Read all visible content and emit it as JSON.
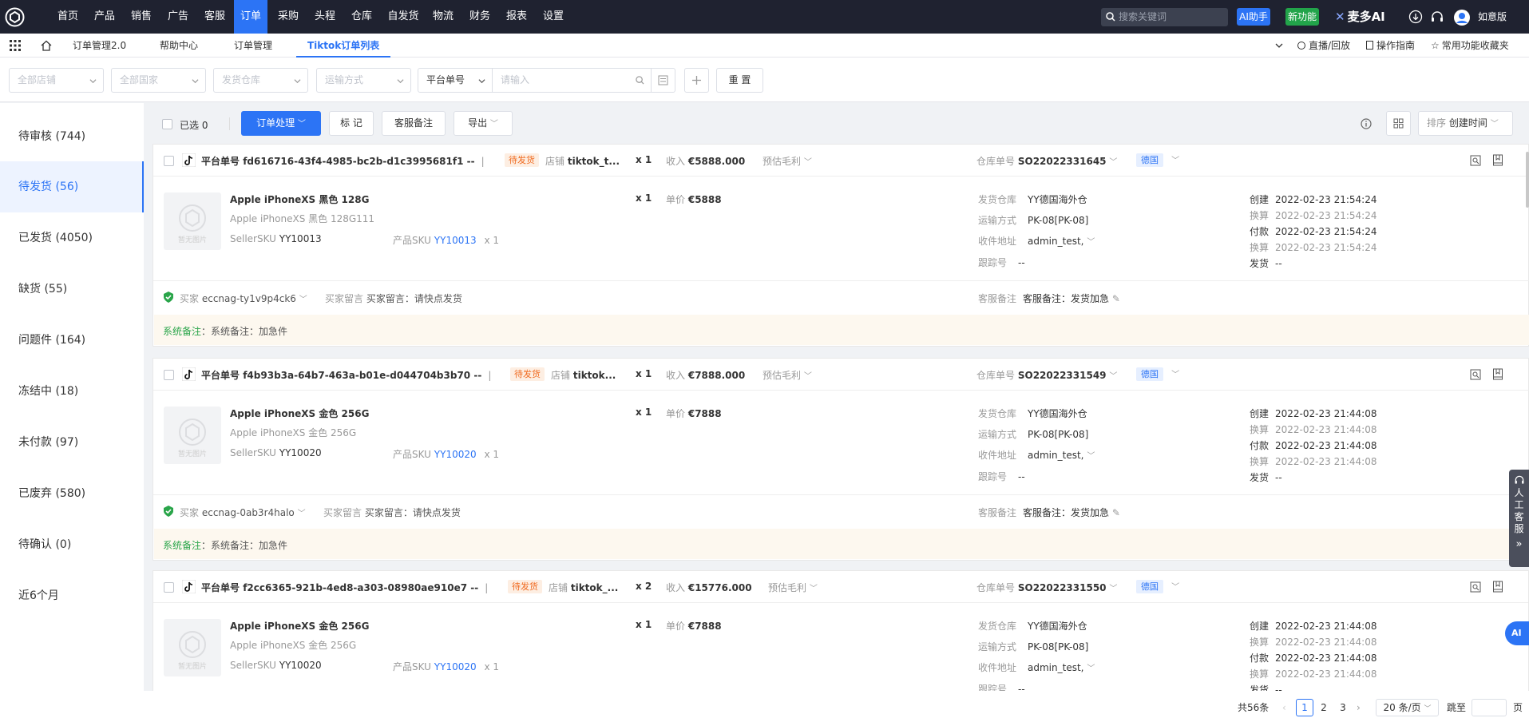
{
  "nav": {
    "items": [
      "首页",
      "产品",
      "销售",
      "广告",
      "客服",
      "订单",
      "采购",
      "头程",
      "仓库",
      "自发货",
      "物流",
      "财务",
      "报表",
      "设置"
    ],
    "active_index": 5,
    "search_placeholder": "搜索关键词",
    "ai_assistant": "AI助手",
    "new_feature": "新功能",
    "brand": "麦多AI",
    "user": "如意版"
  },
  "tabs": {
    "items": [
      "订单管理2.0",
      "帮助中心",
      "订单管理",
      "Tiktok订单列表"
    ],
    "active_index": 3,
    "live": "直播/回放",
    "guide": "操作指南",
    "favorites": "常用功能收藏夹"
  },
  "filters": {
    "store": "全部店铺",
    "country": "全部国家",
    "warehouse": "发货仓库",
    "shipping": "运输方式",
    "platform_field": "平台单号",
    "input_placeholder": "请输入",
    "reset": "重 置"
  },
  "sidebar": [
    {
      "label": "待审核 (744)"
    },
    {
      "label": "待发货 (56)"
    },
    {
      "label": "已发货 (4050)"
    },
    {
      "label": "缺货 (55)"
    },
    {
      "label": "问题件 (164)"
    },
    {
      "label": "冻结中 (18)"
    },
    {
      "label": "未付款 (97)"
    },
    {
      "label": "已废弃 (580)"
    },
    {
      "label": "待确认 (0)"
    },
    {
      "label": "近6个月"
    }
  ],
  "sidebar_active": 1,
  "toolbar": {
    "selected": "已选 0",
    "process": "订单处理",
    "mark": "标 记",
    "cs_remark": "客服备注",
    "export": "导出",
    "sort_label": "排序",
    "sort_value": "创建时间"
  },
  "labels": {
    "platform_no": "平台单号",
    "store": "店铺",
    "income": "收入",
    "profit": "预估毛利",
    "wh_no": "仓库单号",
    "unit_price": "单价",
    "wh": "发货仓库",
    "ship": "运输方式",
    "addr": "收件地址",
    "track": "跟踪号",
    "created": "创建",
    "converted": "换算",
    "paid": "付款",
    "shipped": "发货",
    "buyer": "买家",
    "buyer_msg": "买家留言",
    "cs_remark": "客服备注",
    "sys_remark": "系统备注",
    "no_image": "暂无图片"
  },
  "orders": [
    {
      "order_no": "fd616716-43f4-4985-bc2b-d1c3995681f1",
      "dash": "--",
      "status": "待发货",
      "store": "tiktok_t...",
      "qty": "x 1",
      "income": "€5888.000",
      "wh_no": "SO22022331645",
      "country": "德国",
      "product": "Apple iPhoneXS 黑色 128G",
      "variant": "Apple iPhoneXS 黑色 128G111",
      "seller_sku_label": "SellerSKU",
      "seller_sku": "YY10013",
      "sku_label": "产品SKU",
      "sku": "YY10013",
      "sku_qty": "x 1",
      "item_qty": "x 1",
      "price": "€5888",
      "warehouse": "YY德国海外仓",
      "shipping": "PK-08[PK-08]",
      "address": "admin_test,",
      "tracking": "--",
      "created": "2022-02-23 21:54:24",
      "conv1": "2022-02-23 21:54:24",
      "paid": "2022-02-23 21:54:24",
      "conv2": "2022-02-23 21:54:24",
      "shipped": "--",
      "buyer": "eccnag-ty1v9p4ck6",
      "buyer_msg": "买家留言：请快点发货",
      "cs_remark": "客服备注：发货加急",
      "sys_remark": "：系统备注：加急件"
    },
    {
      "order_no": "f4b93b3a-64b7-463a-b01e-d044704b3b70",
      "dash": "--",
      "status": "待发货",
      "store": "tiktok...",
      "qty": "x 1",
      "income": "€7888.000",
      "wh_no": "SO22022331549",
      "country": "德国",
      "product": "Apple iPhoneXS 金色 256G",
      "variant": "Apple iPhoneXS 金色 256G",
      "seller_sku_label": "SellerSKU",
      "seller_sku": "YY10020",
      "sku_label": "产品SKU",
      "sku": "YY10020",
      "sku_qty": "x 1",
      "item_qty": "x 1",
      "price": "€7888",
      "warehouse": "YY德国海外仓",
      "shipping": "PK-08[PK-08]",
      "address": "admin_test,",
      "tracking": "--",
      "created": "2022-02-23 21:44:08",
      "conv1": "2022-02-23 21:44:08",
      "paid": "2022-02-23 21:44:08",
      "conv2": "2022-02-23 21:44:08",
      "shipped": "--",
      "buyer": "eccnag-0ab3r4halo",
      "buyer_msg": "买家留言：请快点发货",
      "cs_remark": "客服备注：发货加急",
      "sys_remark": "：系统备注：加急件"
    },
    {
      "order_no": "f2cc6365-921b-4ed8-a303-08980ae910e7",
      "dash": "--",
      "status": "待发货",
      "store": "tiktok_...",
      "qty": "x 2",
      "income": "€15776.000",
      "wh_no": "SO22022331550",
      "country": "德国",
      "product": "Apple iPhoneXS 金色 256G",
      "variant": "Apple iPhoneXS 金色 256G",
      "seller_sku_label": "SellerSKU",
      "seller_sku": "YY10020",
      "sku_label": "产品SKU",
      "sku": "YY10020",
      "sku_qty": "x 1",
      "item_qty": "x 1",
      "price": "€7888",
      "warehouse": "YY德国海外仓",
      "shipping": "PK-08[PK-08]",
      "address": "admin_test,",
      "tracking": "--",
      "created": "2022-02-23 21:44:08",
      "conv1": "2022-02-23 21:44:08",
      "paid": "2022-02-23 21:44:08",
      "conv2": "2022-02-23 21:44:08",
      "shipped": "--"
    }
  ],
  "pagination": {
    "total": "共56条",
    "pages": [
      "1",
      "2",
      "3"
    ],
    "current": "1",
    "page_size": "20 条/页",
    "jump": "跳至",
    "unit": "页"
  },
  "float": {
    "service": "人工客服",
    "ai": "AI"
  },
  "colors": {
    "accent": "#2c74f5",
    "nav_bg": "#1f2230",
    "status_orange": "#f06a1f",
    "green": "#2aa54a"
  }
}
